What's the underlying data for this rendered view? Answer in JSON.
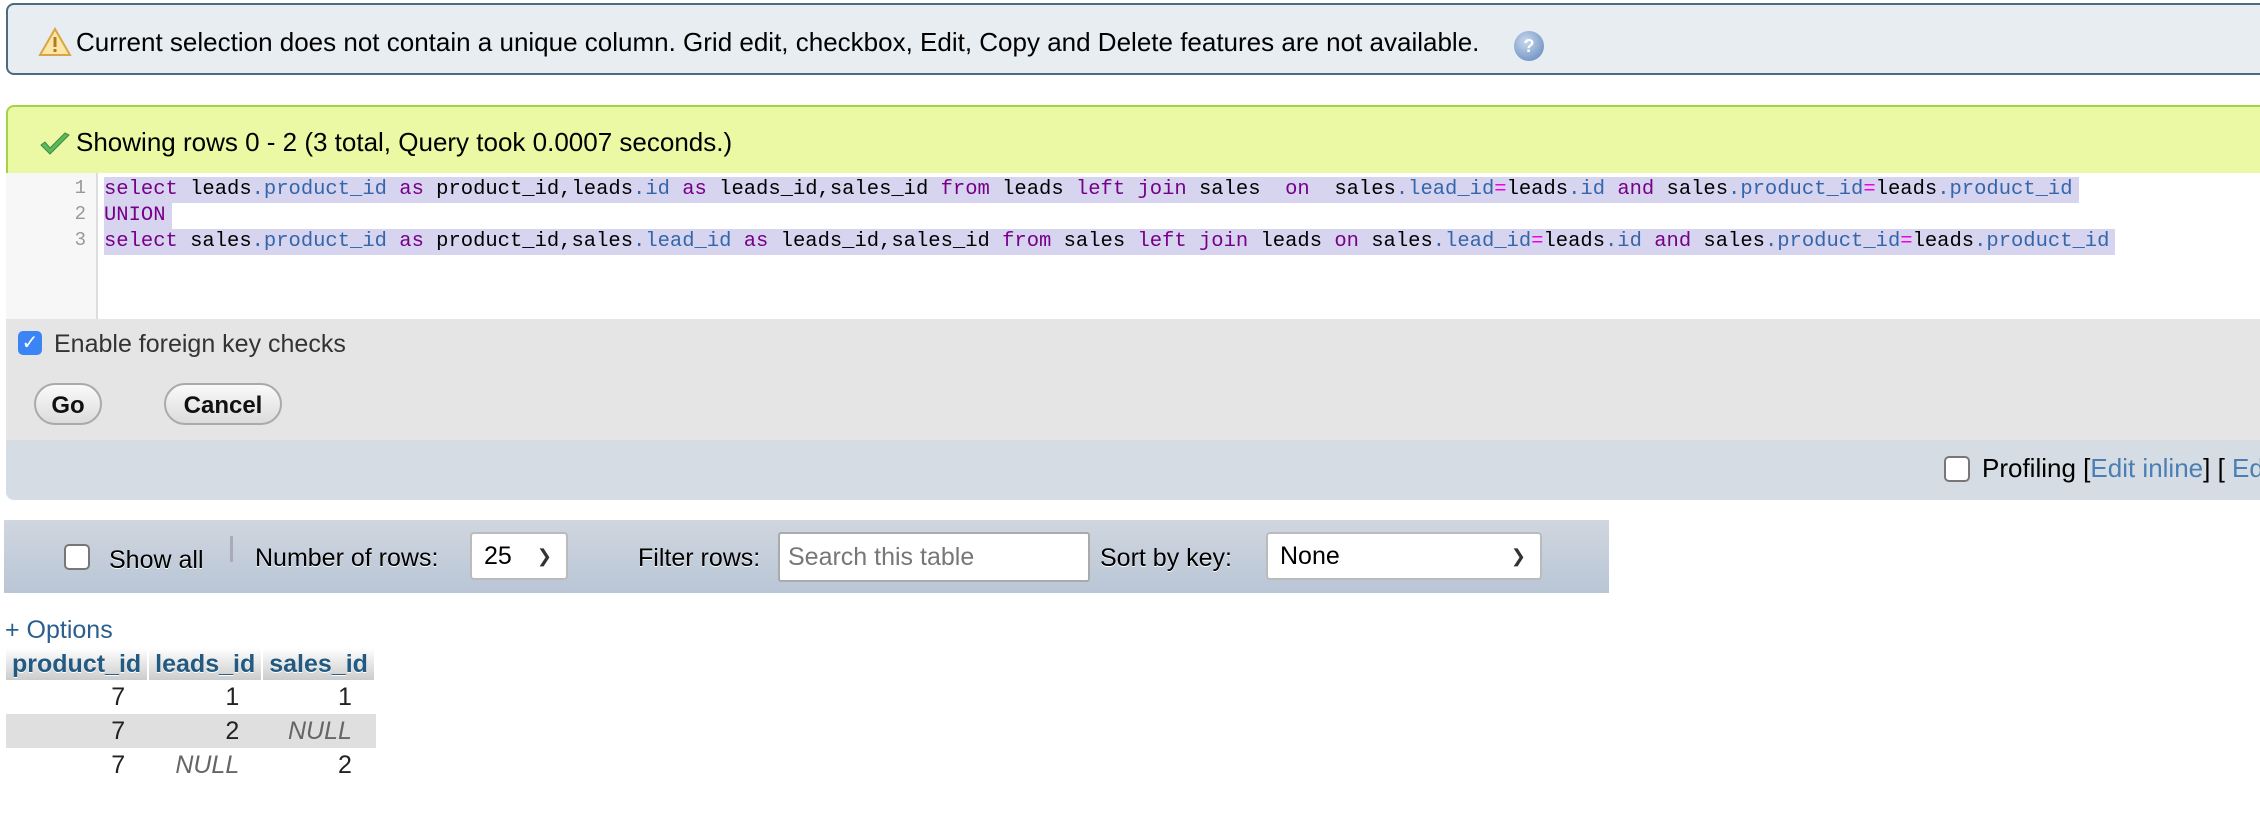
{
  "warning": {
    "icon": "warning-triangle-icon",
    "message": "Current selection does not contain a unique column. Grid edit, checkbox, Edit, Copy and Delete features are not available.",
    "help_icon": "help-icon"
  },
  "success": {
    "icon": "checkmark-icon",
    "message": "Showing rows 0 - 2 (3 total, Query took 0.0007 seconds.)"
  },
  "query": {
    "line_numbers": [
      "1",
      "2",
      "3"
    ],
    "lines": [
      "select leads.product_id as product_id,leads.id as leads_id,sales_id from leads left join sales  on  sales.lead_id=leads.id and sales.product_id=leads.product_id",
      "UNION",
      "select sales.product_id as product_id,sales.lead_id as leads_id,sales_id from sales left join leads on sales.lead_id=leads.id and sales.product_id=leads.product_id"
    ]
  },
  "options": {
    "foreign_key_label": "Enable foreign key checks",
    "foreign_key_checked": true,
    "go_label": "Go",
    "cancel_label": "Cancel"
  },
  "profiling": {
    "label": "Profiling",
    "checked": false,
    "edit_inline": "Edit inline",
    "edit_partial": "Ed"
  },
  "navigation": {
    "show_all_label": "Show all",
    "show_all_checked": false,
    "rows_label": "Number of rows:",
    "rows_value": "25",
    "filter_label": "Filter rows:",
    "filter_placeholder": "Search this table",
    "sort_label": "Sort by key:",
    "sort_value": "None"
  },
  "results": {
    "options_link": "+ Options",
    "columns": [
      "product_id",
      "leads_id",
      "sales_id"
    ],
    "rows": [
      [
        "7",
        "1",
        "1"
      ],
      [
        "7",
        "2",
        "NULL"
      ],
      [
        "7",
        "NULL",
        "2"
      ]
    ]
  },
  "colors": {
    "warning_bg": "#e8edf1",
    "success_bg": "#ebf8a4",
    "link": "#4a7fb5",
    "header_text": "#235a81",
    "sql_keyword": "#770088",
    "sql_property": "#3366aa"
  }
}
